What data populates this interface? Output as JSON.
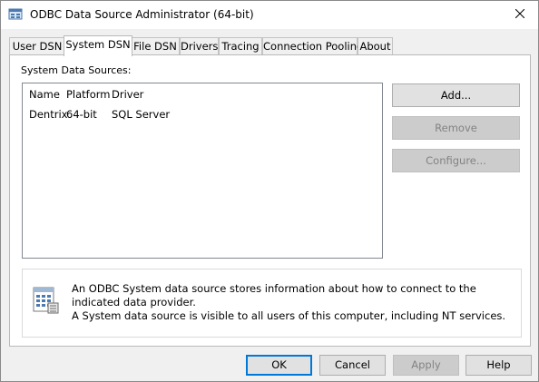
{
  "window": {
    "title": "ODBC Data Source Administrator (64-bit)",
    "title_icon": "odbc-app-icon",
    "close_icon": "close-icon"
  },
  "tabs": [
    {
      "label": "User DSN",
      "active": false
    },
    {
      "label": "System DSN",
      "active": true
    },
    {
      "label": "File DSN",
      "active": false
    },
    {
      "label": "Drivers",
      "active": false
    },
    {
      "label": "Tracing",
      "active": false
    },
    {
      "label": "Connection Pooling",
      "active": false
    },
    {
      "label": "About",
      "active": false
    }
  ],
  "system_dsn": {
    "group_label": "System Data Sources:",
    "columns": [
      "Name",
      "Platform",
      "Driver"
    ],
    "rows": [
      {
        "name": "Dentrix",
        "platform": "64-bit",
        "driver": "SQL Server"
      }
    ],
    "buttons": {
      "add": "Add...",
      "remove": "Remove",
      "configure": "Configure..."
    },
    "info": {
      "icon": "data-source-icon",
      "line1": "An ODBC System data source stores information about how to connect to the indicated data provider.",
      "line2": "A System data source is visible to all users of this computer, including NT services."
    }
  },
  "dialog_buttons": {
    "ok": "OK",
    "cancel": "Cancel",
    "apply": "Apply",
    "help": "Help"
  },
  "colors": {
    "accent": "#0078d7",
    "disabled_text": "#838383"
  }
}
